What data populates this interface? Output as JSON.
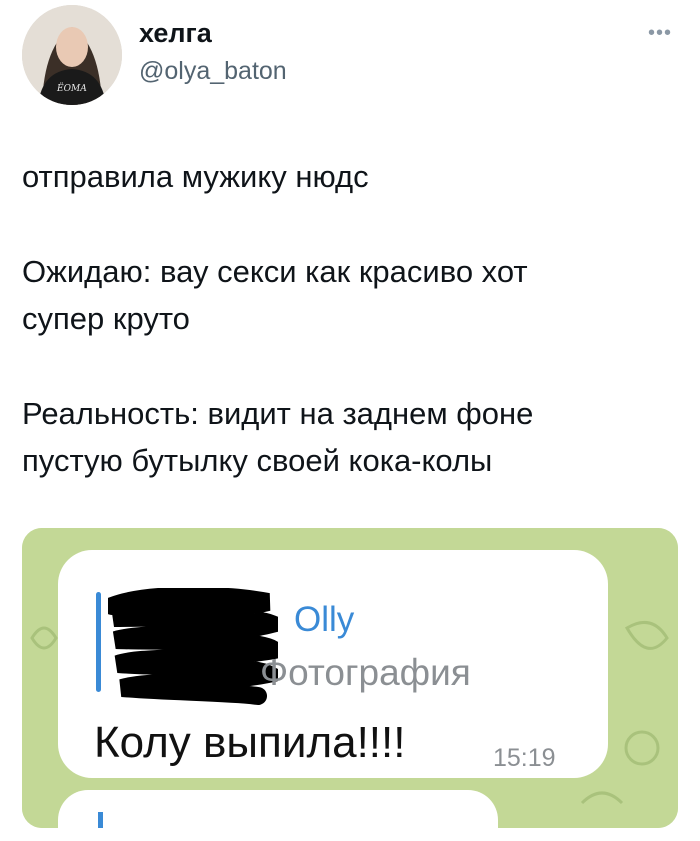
{
  "author": {
    "display_name": "хелга",
    "handle": "@olya_baton",
    "avatar_shirt_text": "ЁОМА ИЕТА"
  },
  "menu_icon": "more-dots-icon",
  "tweet": {
    "line1": "отправила мужику нюдс",
    "line2": "Ожидаю: вау секси как красиво хот",
    "line3": "супер круто",
    "line4": "Реальность: видит на заднем фоне",
    "line5": "пустую бутылку своей кока-колы"
  },
  "telegram": {
    "reply_name": "Olly",
    "reply_type": "Фотография",
    "message": "Колу выпила!!!!",
    "time": "15:19",
    "colors": {
      "accent": "#3a8ad6",
      "background": "#c5d99a"
    }
  }
}
